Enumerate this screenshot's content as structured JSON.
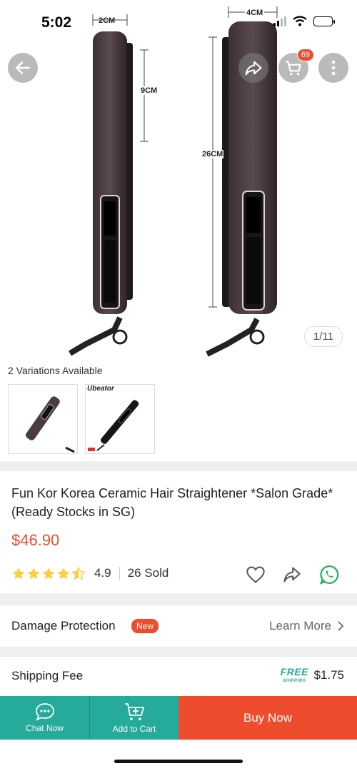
{
  "status_bar": {
    "time": "5:02"
  },
  "gallery": {
    "dimensions": {
      "width_left": "2CM",
      "height_left": "9CM",
      "width_right": "4CM",
      "height_right": "26CM"
    },
    "page_indicator": "1/11",
    "cart_count": "69",
    "thumb_brand": "Ubeator"
  },
  "variations": {
    "label": "2 Variations Available",
    "count": 2
  },
  "product": {
    "title": "Fun Kor Korea Ceramic Hair Straightener *Salon Grade* (Ready Stocks in SG)",
    "price": "$46.90",
    "rating": "4.9",
    "rating_stars": 4.5,
    "sold": "26 Sold"
  },
  "damage_protection": {
    "label": "Damage Protection",
    "badge": "New",
    "link": "Learn More"
  },
  "shipping": {
    "label": "Shipping Fee",
    "free_line1": "FREE",
    "free_line2": "SHIPPING",
    "fee": "$1.75"
  },
  "bottom_bar": {
    "chat": "Chat Now",
    "add_to_cart": "Add to Cart",
    "buy_now": "Buy Now"
  },
  "colors": {
    "brand": "#ee4d2d",
    "teal": "#26aa99",
    "star": "#ffce3d"
  },
  "icons": [
    "back-arrow-icon",
    "share-icon",
    "cart-icon",
    "more-icon",
    "star-icon",
    "heart-icon",
    "whatsapp-icon",
    "chat-icon",
    "add-cart-icon",
    "chevron-right-icon"
  ]
}
